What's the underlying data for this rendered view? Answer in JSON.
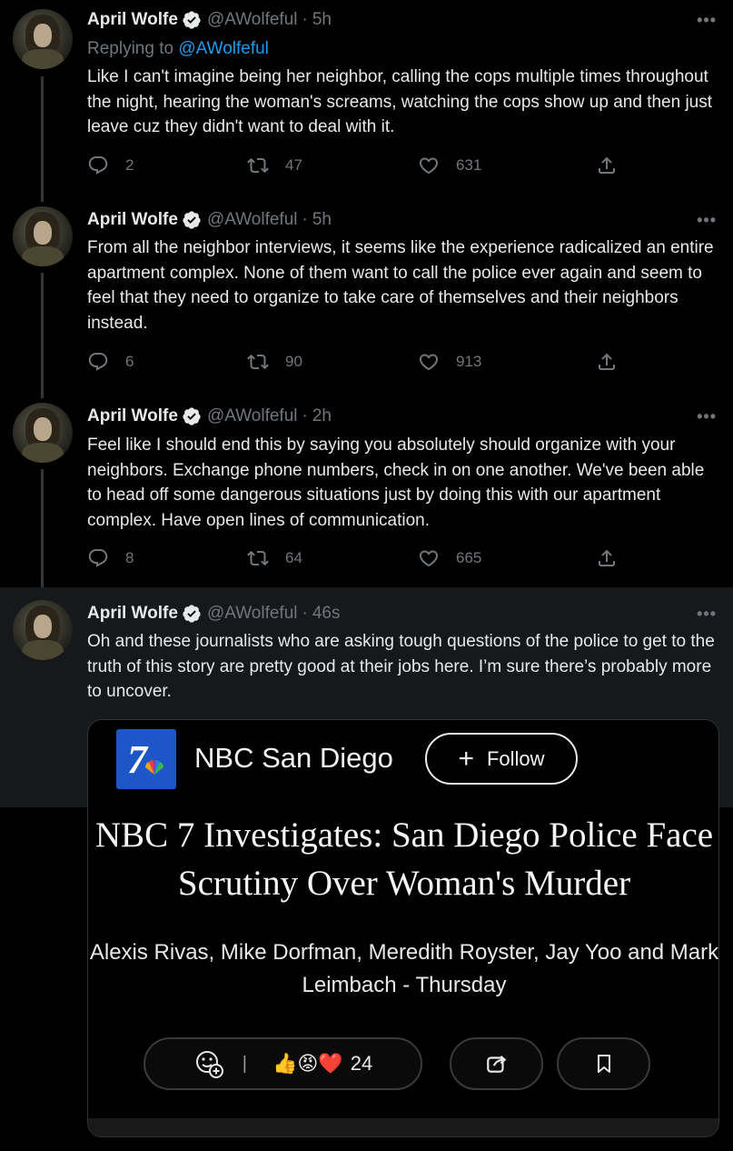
{
  "author": {
    "name": "April Wolfe",
    "handle": "@AWolfeful"
  },
  "tweets": [
    {
      "time": "5h",
      "replying_to_prefix": "Replying to",
      "replying_to_handle": "@AWolfeful",
      "text": "Like I can't imagine being her neighbor, calling the cops multiple times throughout the night, hearing the woman's screams, watching the cops show up and then just leave cuz they didn't want to deal with it.",
      "replies": "2",
      "retweets": "47",
      "likes": "631"
    },
    {
      "time": "5h",
      "text": "From all the neighbor interviews, it seems like the experience radicalized an entire apartment complex. None of them want to call the police ever again and seem to feel that they need to organize to take care of themselves and their neighbors instead.",
      "replies": "6",
      "retweets": "90",
      "likes": "913"
    },
    {
      "time": "2h",
      "text": "Feel like I should end this by saying you absolutely should organize with your neighbors. Exchange phone numbers, check in on one another. We've been able to head off some dangerous situations just by doing this with our apartment complex. Have open lines of communication.",
      "replies": "8",
      "retweets": "64",
      "likes": "665"
    },
    {
      "time": "46s",
      "text": "Oh and these journalists who are asking tough questions of the police to get to the truth of this story are pretty good at their jobs here. I’m sure there’s probably more to uncover."
    }
  ],
  "card": {
    "logo_text": "7",
    "outlet": "NBC San Diego",
    "follow_label": "Follow",
    "headline": "NBC 7 Investigates: San Diego Police Face Scrutiny Over Woman's Murder",
    "byline": "Alexis Rivas, Mike Dorfman, Meredith Royster, Jay Yoo and Mark Leimbach - Thursday",
    "reaction_separator": "|",
    "reaction_emojis": "👍😡❤️",
    "reaction_count": "24"
  },
  "ui": {
    "more_glyph": "•••",
    "dot": "·",
    "verified_color": "#e7e9ea",
    "link_color": "#1d9bf0"
  }
}
